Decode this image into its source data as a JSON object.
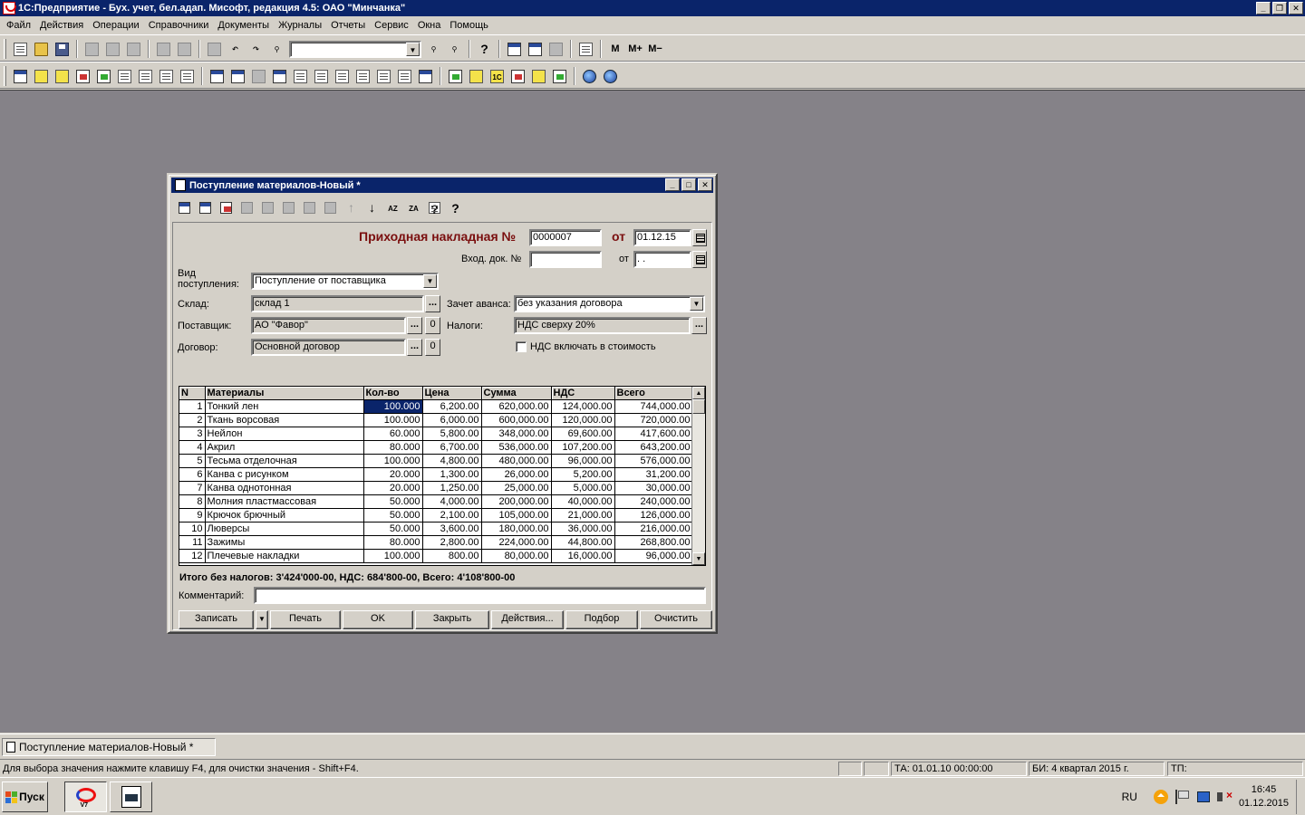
{
  "app": {
    "title": "1С:Предприятие - Бух. учет, бел.адап. Мисофт, редакция 4.5: ОАО \"Минчанка\""
  },
  "menu": [
    "Файл",
    "Действия",
    "Операции",
    "Справочники",
    "Документы",
    "Журналы",
    "Отчеты",
    "Сервис",
    "Окна",
    "Помощь"
  ],
  "toolbar": {
    "search_value": "",
    "m_label": "M",
    "m_plus_label": "M+",
    "m_minus_label": "M−"
  },
  "doc_window": {
    "title": "Поступление материалов-Новый *",
    "header_label": "Приходная накладная №",
    "number": "0000007",
    "from_label": "от",
    "date": "01.12.15",
    "incoming_doc_label": "Вход. док. №",
    "incoming_doc_value": "",
    "incoming_from_label": "от",
    "incoming_date_value": " .  .",
    "receipt_type_label_1": "Вид",
    "receipt_type_label_2": "поступления:",
    "receipt_type_value": "Поступление от поставщика",
    "warehouse_label": "Склад:",
    "warehouse_value": "склад 1",
    "advance_label": "Зачет аванса:",
    "advance_value": "без указания договора",
    "supplier_label": "Поставщик:",
    "supplier_value": "АО \"Фавор\"",
    "taxes_label": "Налоги:",
    "taxes_value": "НДС сверху 20%",
    "contract_label": "Договор:",
    "contract_value": "Основной договор",
    "vat_in_cost_label": "НДС включать в стоимость",
    "ellipsis": "...",
    "zero": "0",
    "columns": [
      "N",
      "Материалы",
      "Кол-во",
      "Цена",
      "Сумма",
      "НДС",
      "Всего"
    ],
    "rows": [
      [
        "1",
        "Тонкий лен",
        "100.000",
        "6,200.00",
        "620,000.00",
        "124,000.00",
        "744,000.00"
      ],
      [
        "2",
        "Ткань ворсовая",
        "100.000",
        "6,000.00",
        "600,000.00",
        "120,000.00",
        "720,000.00"
      ],
      [
        "3",
        "Нейлон",
        "60.000",
        "5,800.00",
        "348,000.00",
        "69,600.00",
        "417,600.00"
      ],
      [
        "4",
        "Акрил",
        "80.000",
        "6,700.00",
        "536,000.00",
        "107,200.00",
        "643,200.00"
      ],
      [
        "5",
        "Тесьма отделочная",
        "100.000",
        "4,800.00",
        "480,000.00",
        "96,000.00",
        "576,000.00"
      ],
      [
        "6",
        "Канва с рисунком",
        "20.000",
        "1,300.00",
        "26,000.00",
        "5,200.00",
        "31,200.00"
      ],
      [
        "7",
        "Канва однотонная",
        "20.000",
        "1,250.00",
        "25,000.00",
        "5,000.00",
        "30,000.00"
      ],
      [
        "8",
        "Молния пластмассовая",
        "50.000",
        "4,000.00",
        "200,000.00",
        "40,000.00",
        "240,000.00"
      ],
      [
        "9",
        "Крючок брючный",
        "50.000",
        "2,100.00",
        "105,000.00",
        "21,000.00",
        "126,000.00"
      ],
      [
        "10",
        "Люверсы",
        "50.000",
        "3,600.00",
        "180,000.00",
        "36,000.00",
        "216,000.00"
      ],
      [
        "11",
        "Зажимы",
        "80.000",
        "2,800.00",
        "224,000.00",
        "44,800.00",
        "268,800.00"
      ],
      [
        "12",
        "Плечевые накладки",
        "100.000",
        "800.00",
        "80,000.00",
        "16,000.00",
        "96,000.00"
      ]
    ],
    "totals": "Итого без налогов: 3'424'000-00, НДС: 684'800-00, Всего: 4'108'800-00",
    "comment_label": "Комментарий:",
    "comment_value": "",
    "buttons": {
      "save": "Записать",
      "print": "Печать",
      "ok": "OK",
      "close": "Закрыть",
      "actions": "Действия...",
      "select": "Подбор",
      "clear": "Очистить"
    }
  },
  "window_tab": "Поступление материалов-Новый *",
  "status": {
    "hint": "Для выбора значения нажмите клавишу F4, для очистки значения - Shift+F4.",
    "ta": "ТА: 01.01.10  00:00:00",
    "bi": "БИ: 4 квартал 2015 г.",
    "tp": "ТП:"
  },
  "taskbar": {
    "start_label": "Пуск",
    "lang": "RU",
    "time": "16:45",
    "date": "01.12.2015"
  }
}
